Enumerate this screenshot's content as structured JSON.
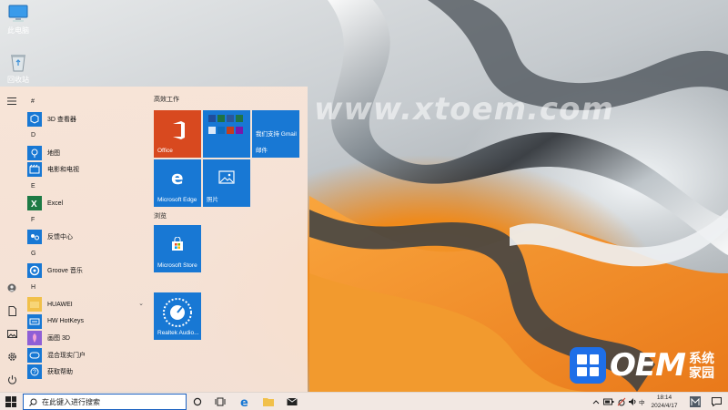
{
  "desktop": {
    "icons": [
      {
        "label": "此电脑",
        "icon": "this-pc-icon"
      },
      {
        "label": "回收站",
        "icon": "recycle-bin-icon"
      }
    ],
    "watermark": "www.xtoem.com",
    "brand": {
      "text": "OEM",
      "sub1": "系统",
      "sub2": "家园"
    }
  },
  "start_menu": {
    "rail": [
      "hamburger-menu-icon",
      "user-icon",
      "document-icon",
      "pictures-icon",
      "settings-icon",
      "power-icon"
    ],
    "app_list": [
      {
        "type": "letter",
        "label": "#"
      },
      {
        "type": "app",
        "label": "3D 查看器",
        "icon": "3d-viewer-icon"
      },
      {
        "type": "letter",
        "label": "D"
      },
      {
        "type": "app",
        "label": "地图",
        "icon": "maps-icon"
      },
      {
        "type": "app",
        "label": "电影和电视",
        "icon": "movies-tv-icon"
      },
      {
        "type": "letter",
        "label": "E"
      },
      {
        "type": "app",
        "label": "Excel",
        "icon": "excel-icon"
      },
      {
        "type": "letter",
        "label": "F"
      },
      {
        "type": "app",
        "label": "反馈中心",
        "icon": "feedback-hub-icon"
      },
      {
        "type": "letter",
        "label": "G"
      },
      {
        "type": "app",
        "label": "Groove 音乐",
        "icon": "groove-music-icon"
      },
      {
        "type": "letter",
        "label": "H"
      },
      {
        "type": "app",
        "label": "HUAWEI",
        "icon": "folder-icon",
        "expandable": true
      },
      {
        "type": "app",
        "label": "HW HotKeys",
        "icon": "hw-hotkeys-icon"
      },
      {
        "type": "app",
        "label": "画图 3D",
        "icon": "paint-3d-icon"
      },
      {
        "type": "app",
        "label": "混合现实门户",
        "icon": "mixed-reality-icon"
      },
      {
        "type": "app",
        "label": "获取帮助",
        "icon": "get-help-icon"
      }
    ],
    "tile_groups": [
      {
        "title": "高效工作"
      },
      {
        "title": "浏览"
      }
    ],
    "tiles": {
      "office": "Office",
      "gmail": "我们支持 Gmail",
      "mail": "邮件",
      "edge": "Microsoft Edge",
      "photos": "照片",
      "store": "Microsoft Store",
      "realtek": "Realtek Audio..."
    }
  },
  "taskbar": {
    "search_placeholder": "在此键入进行搜索",
    "pinned": [
      "cortana-icon",
      "task-view-icon",
      "edge-icon",
      "file-explorer-icon",
      "mail-icon"
    ],
    "tray": {
      "ime": "中",
      "time": "18:14",
      "date": "2024/4/17"
    }
  }
}
